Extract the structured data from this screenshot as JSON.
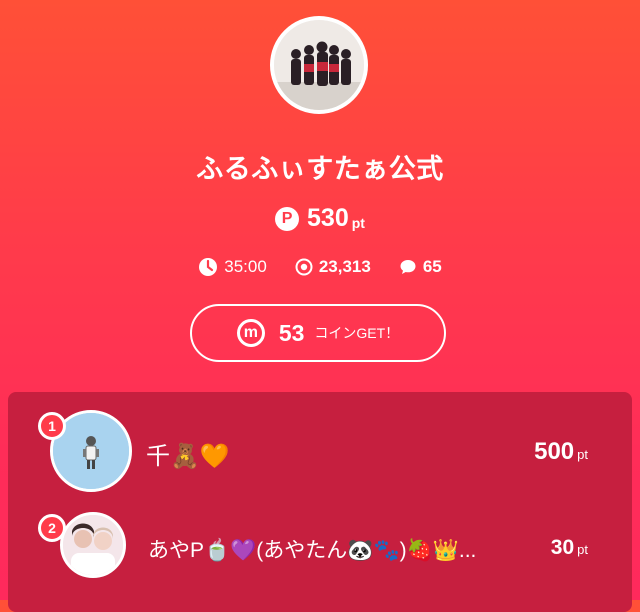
{
  "profile": {
    "avatar_icon": "group-photo-avatar",
    "name": "ふるふぃすたぁ公式"
  },
  "points": {
    "icon": "P",
    "value": "530",
    "unit": "pt"
  },
  "stats": {
    "time": "35:00",
    "views": "23,313",
    "comments": "65"
  },
  "coin_button": {
    "icon": "m",
    "count": "53",
    "label": "コインGET！"
  },
  "ranking": [
    {
      "rank": "1",
      "name": "千🧸🧡",
      "points": "500",
      "unit": "pt"
    },
    {
      "rank": "2",
      "name": "あやP🍵💜(あやたん🐼🐾)🍓👑...",
      "points": "30",
      "unit": "pt"
    }
  ],
  "colors": {
    "accent": "#ff3b4a",
    "ranking_bg": "#c61f3f"
  }
}
